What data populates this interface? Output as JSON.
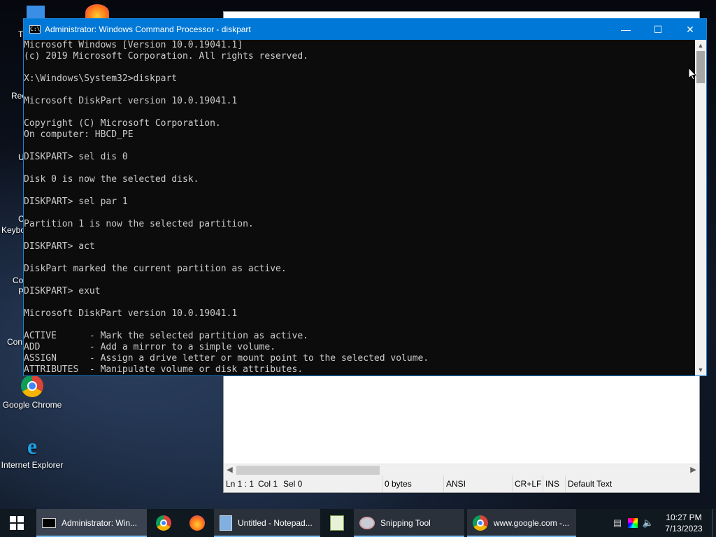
{
  "desktop": {
    "icons": [
      {
        "label": "Google Chrome"
      },
      {
        "label": "Internet Explorer"
      }
    ],
    "partial_labels": [
      "T",
      "Rec",
      "U",
      "C",
      "Keybo",
      "Co",
      "P",
      "Con"
    ]
  },
  "cmd": {
    "title": "Administrator: Windows Command Processor - diskpart",
    "lines": [
      "Microsoft Windows [Version 10.0.19041.1]",
      "(c) 2019 Microsoft Corporation. All rights reserved.",
      "",
      "X:\\Windows\\System32>diskpart",
      "",
      "Microsoft DiskPart version 10.0.19041.1",
      "",
      "Copyright (C) Microsoft Corporation.",
      "On computer: HBCD_PE",
      "",
      "DISKPART> sel dis 0",
      "",
      "Disk 0 is now the selected disk.",
      "",
      "DISKPART> sel par 1",
      "",
      "Partition 1 is now the selected partition.",
      "",
      "DISKPART> act",
      "",
      "DiskPart marked the current partition as active.",
      "",
      "DISKPART> exut",
      "",
      "Microsoft DiskPart version 10.0.19041.1",
      "",
      "ACTIVE      - Mark the selected partition as active.",
      "ADD         - Add a mirror to a simple volume.",
      "ASSIGN      - Assign a drive letter or mount point to the selected volume.",
      "ATTRIBUTES  - Manipulate volume or disk attributes."
    ]
  },
  "notepad": {
    "status": {
      "position": "Ln 1 : 1",
      "col": "Col 1",
      "sel": "Sel 0",
      "size": "0 bytes",
      "encoding": "ANSI",
      "eol": "CR+LF",
      "mode": "INS",
      "style": "Default Text"
    }
  },
  "taskbar": {
    "items": [
      {
        "label": "Administrator: Win...",
        "icon": "cmd-icon"
      },
      {
        "label": "",
        "icon": "chrome-icon"
      },
      {
        "label": "",
        "icon": "firefox-icon"
      },
      {
        "label": "Untitled - Notepad...",
        "icon": "notepad-icon"
      },
      {
        "label": "",
        "icon": "notepad-plus-icon"
      },
      {
        "label": "Snipping Tool",
        "icon": "snipping-tool-icon"
      },
      {
        "label": "www.google.com -...",
        "icon": "chrome-icon"
      }
    ],
    "clock": {
      "time": "10:27 PM",
      "date": "7/13/2023"
    }
  },
  "colors": {
    "titlebar": "#0078d7",
    "console_bg": "#0c0c0c",
    "console_fg": "#cccccc",
    "taskbar": "#101820"
  }
}
